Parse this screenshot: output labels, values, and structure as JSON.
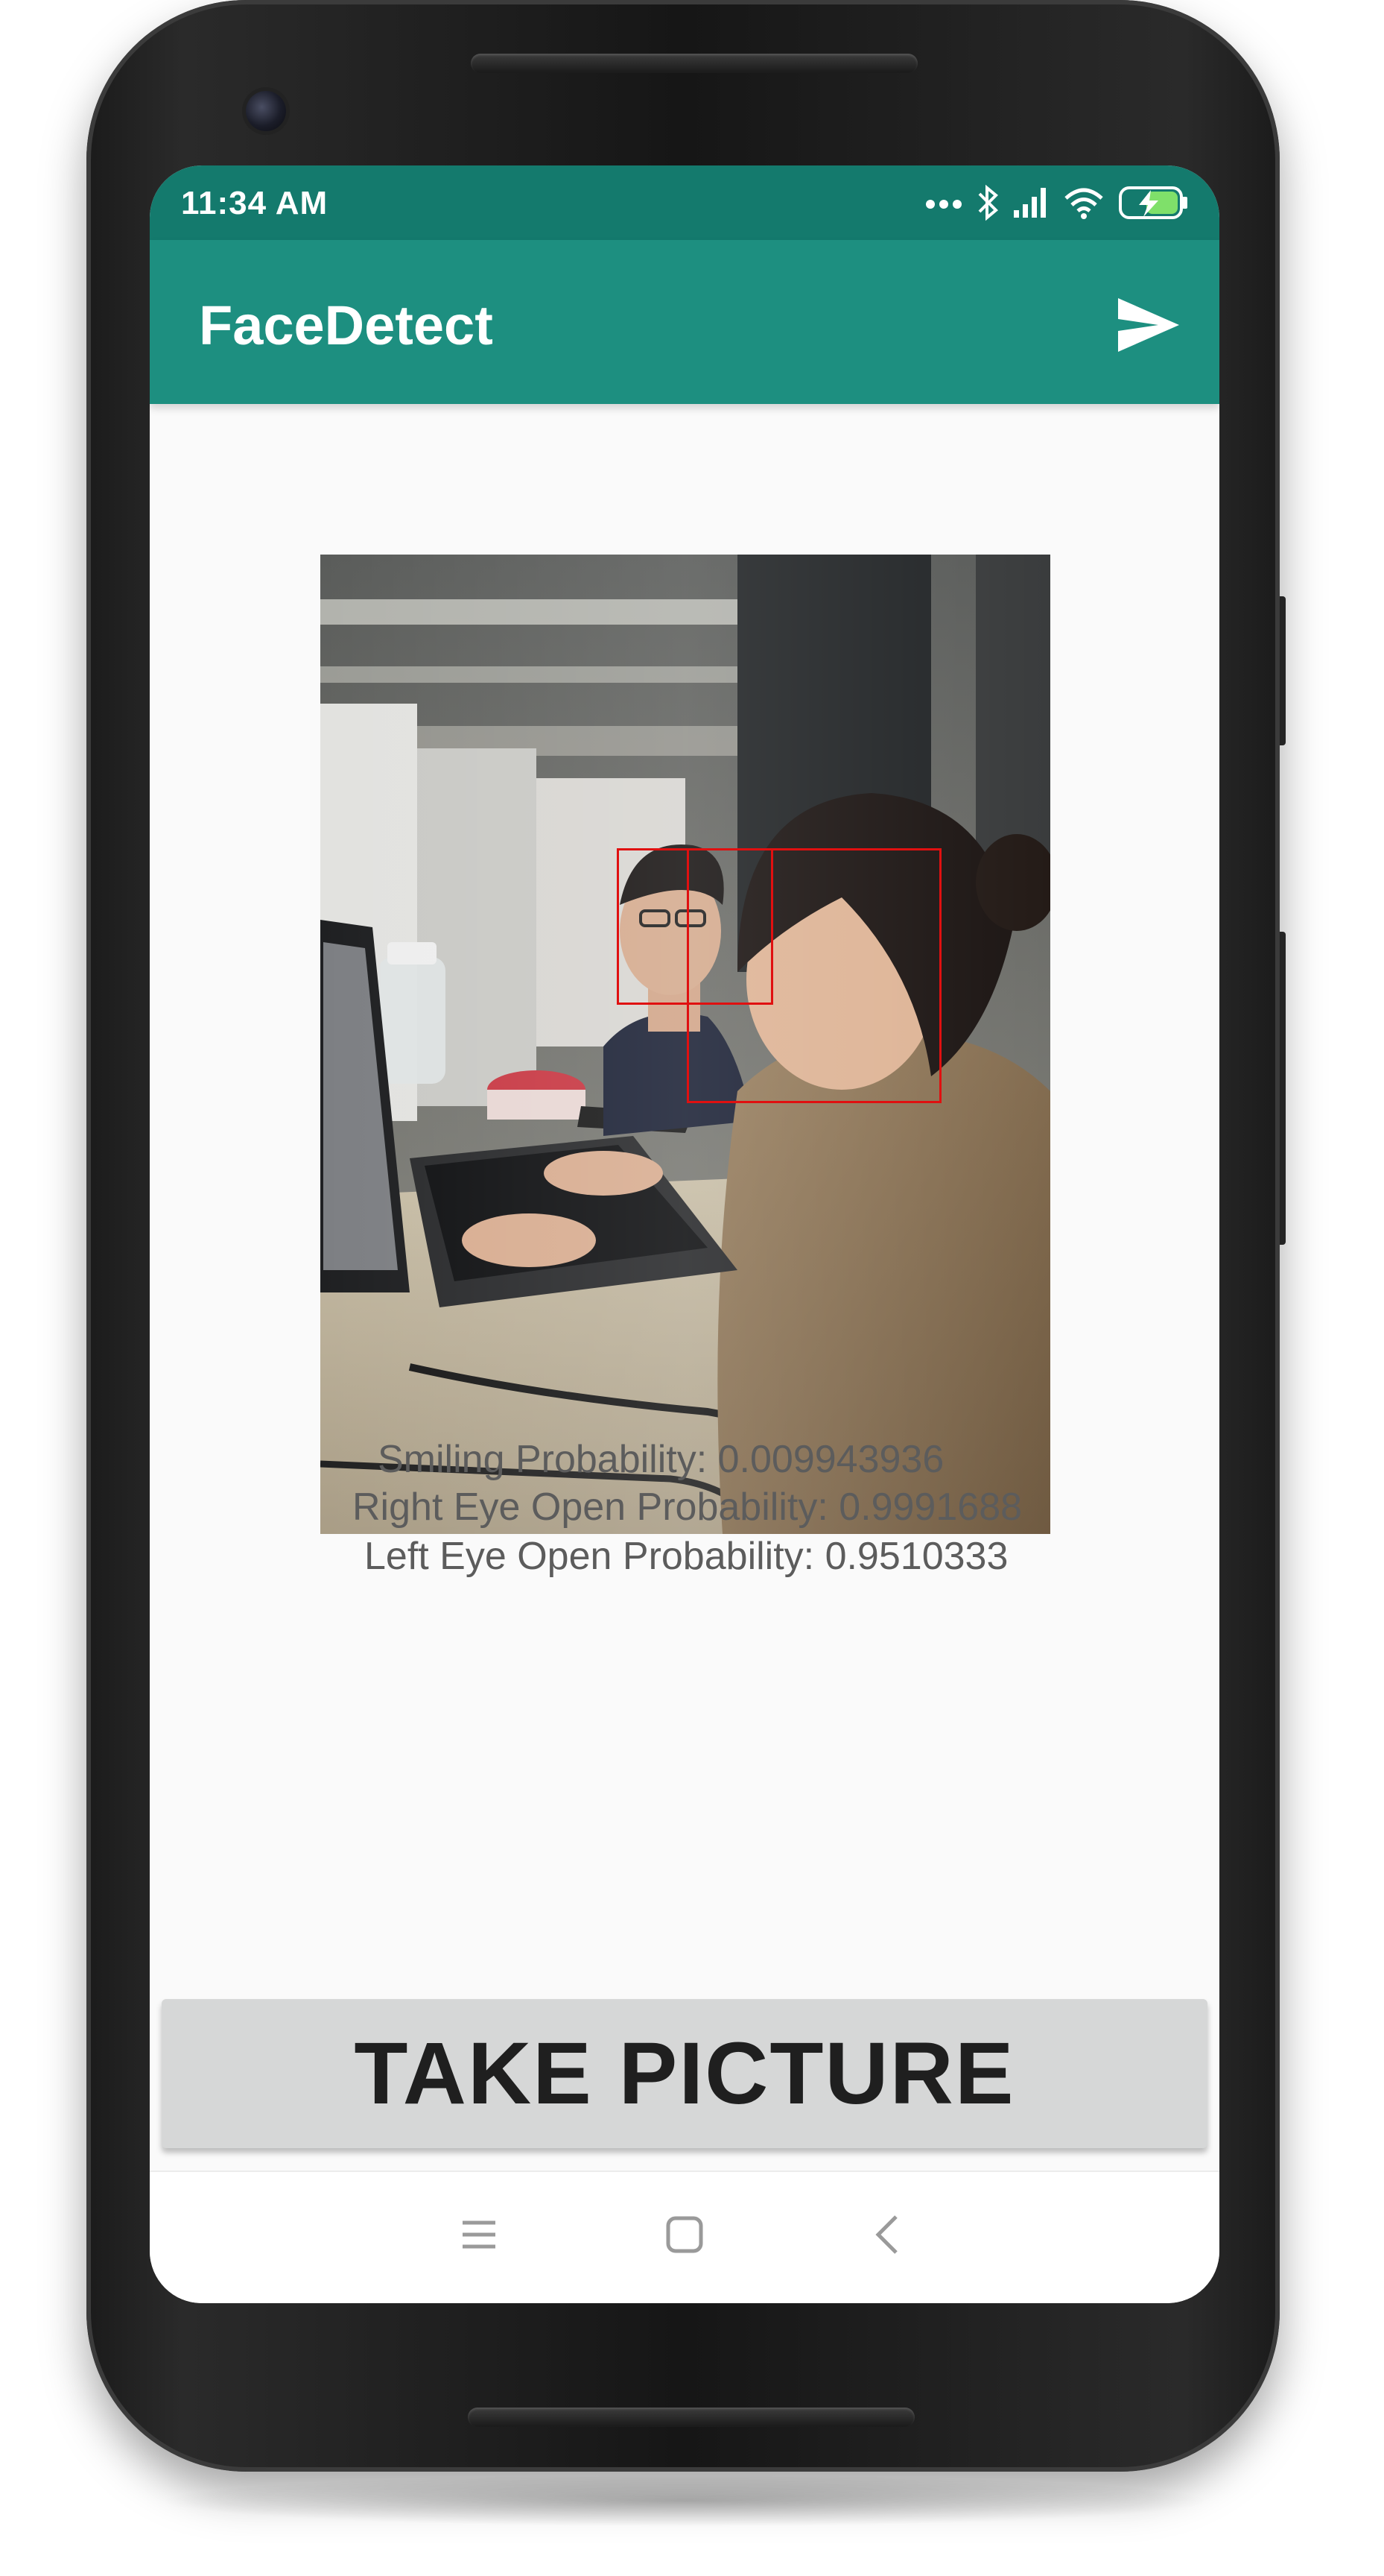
{
  "status_bar": {
    "time": "11:34 AM",
    "icons": [
      "more-dots-icon",
      "bluetooth-icon",
      "signal-icon",
      "wifi-icon",
      "battery-charging-icon"
    ]
  },
  "app_bar": {
    "title": "FaceDetect",
    "action_icon": "send-icon",
    "color": "#1d8f80",
    "status_color": "#147a6d"
  },
  "detection": {
    "faces_detected": 2,
    "box_color": "#e01010",
    "smiling": "Smiling Probability: 0.009943936",
    "right_eye": "Right Eye Open Probability: 0.9991688",
    "left_eye": "Left Eye Open Probability: 0.9510333"
  },
  "actions": {
    "take_picture": "TAKE PICTURE"
  },
  "nav_bar": {
    "icons": [
      "menu-icon",
      "home-icon",
      "back-icon"
    ]
  }
}
